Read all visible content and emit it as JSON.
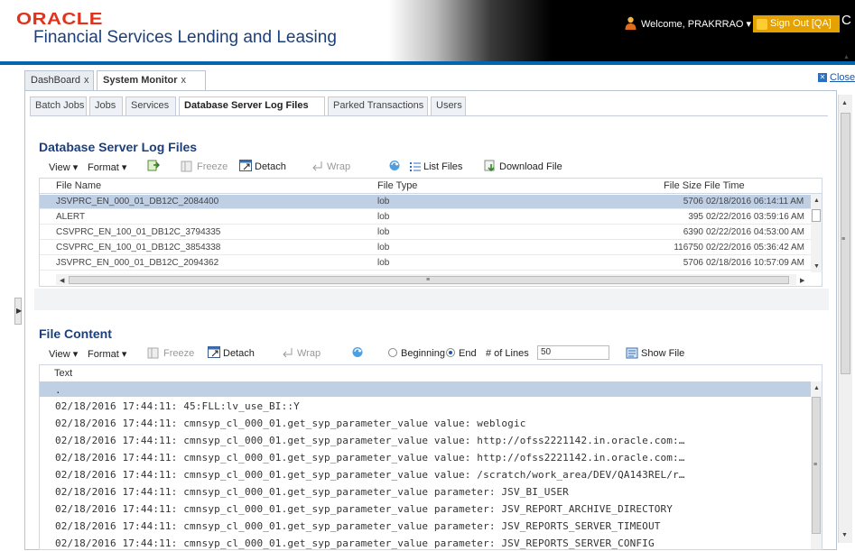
{
  "header": {
    "logo_text": "ORACLE",
    "app_title": "Financial Services Lending and Leasing",
    "welcome": "Welcome, PRAKRRAO ▾",
    "sign_out": "Sign Out [QA]",
    "help": "C"
  },
  "main_tabs": [
    {
      "label": "DashBoard",
      "close": "x"
    },
    {
      "label": "System Monitor",
      "close": "x"
    }
  ],
  "close_label": "Close",
  "sub_tabs": [
    "Batch Jobs",
    "Jobs",
    "Services",
    "Database Server Log Files",
    "Parked Transactions",
    "Users"
  ],
  "log_files": {
    "title": "Database Server Log Files",
    "toolbar": {
      "view": "View ▾",
      "format": "Format ▾",
      "freeze": "Freeze",
      "detach": "Detach",
      "wrap": "Wrap",
      "list_files": "List Files",
      "download_file": "Download File"
    },
    "columns": [
      "File Name",
      "File Type",
      "File Size",
      "File Time"
    ],
    "rows": [
      {
        "name": "JSVPRC_EN_000_01_DB12C_2084400",
        "type": "lob",
        "size": "5706",
        "time": "02/18/2016 06:14:11 AM"
      },
      {
        "name": "ALERT",
        "type": "lob",
        "size": "395",
        "time": "02/22/2016 03:59:16 AM"
      },
      {
        "name": "CSVPRC_EN_100_01_DB12C_3794335",
        "type": "lob",
        "size": "6390",
        "time": "02/22/2016 04:53:00 AM"
      },
      {
        "name": "CSVPRC_EN_100_01_DB12C_3854338",
        "type": "lob",
        "size": "116750",
        "time": "02/22/2016 05:36:42 AM"
      },
      {
        "name": "JSVPRC_EN_000_01_DB12C_2094362",
        "type": "lob",
        "size": "5706",
        "time": "02/18/2016 10:57:09 AM"
      }
    ]
  },
  "file_content": {
    "title": "File Content",
    "toolbar": {
      "view": "View ▾",
      "format": "Format ▾",
      "freeze": "Freeze",
      "detach": "Detach",
      "wrap": "Wrap",
      "beginning": "Beginning",
      "end": "End",
      "lines_label": "# of Lines",
      "lines_value": "50",
      "show_file": "Show File"
    },
    "column": "Text",
    "lines": [
      ".",
      "02/18/2016 17:44:11: 45:FLL:lv_use_BI::Y",
      "02/18/2016 17:44:11: cmnsyp_cl_000_01.get_syp_parameter_value value: weblogic",
      "02/18/2016 17:44:11: cmnsyp_cl_000_01.get_syp_parameter_value value: http://ofss2221142.in.oracle.com:…",
      "02/18/2016 17:44:11: cmnsyp_cl_000_01.get_syp_parameter_value value: http://ofss2221142.in.oracle.com:…",
      "02/18/2016 17:44:11: cmnsyp_cl_000_01.get_syp_parameter_value value: /scratch/work_area/DEV/QA143REL/r…",
      "02/18/2016 17:44:11: cmnsyp_cl_000_01.get_syp_parameter_value parameter: JSV_BI_USER",
      "02/18/2016 17:44:11: cmnsyp_cl_000_01.get_syp_parameter_value parameter: JSV_REPORT_ARCHIVE_DIRECTORY",
      "02/18/2016 17:44:11: cmnsyp_cl_000_01.get_syp_parameter_value parameter: JSV_REPORTS_SERVER_TIMEOUT",
      "02/18/2016 17:44:11: cmnsyp_cl_000_01.get_syp_parameter_value parameter: JSV_REPORTS_SERVER_CONFIG"
    ]
  },
  "colors": {
    "accent": "#1c3f7c",
    "oracle_red": "#e3321b",
    "selection": "#bfcfe4",
    "sign_out_bg": "#e5a100",
    "top_bar": "#0066b2"
  }
}
